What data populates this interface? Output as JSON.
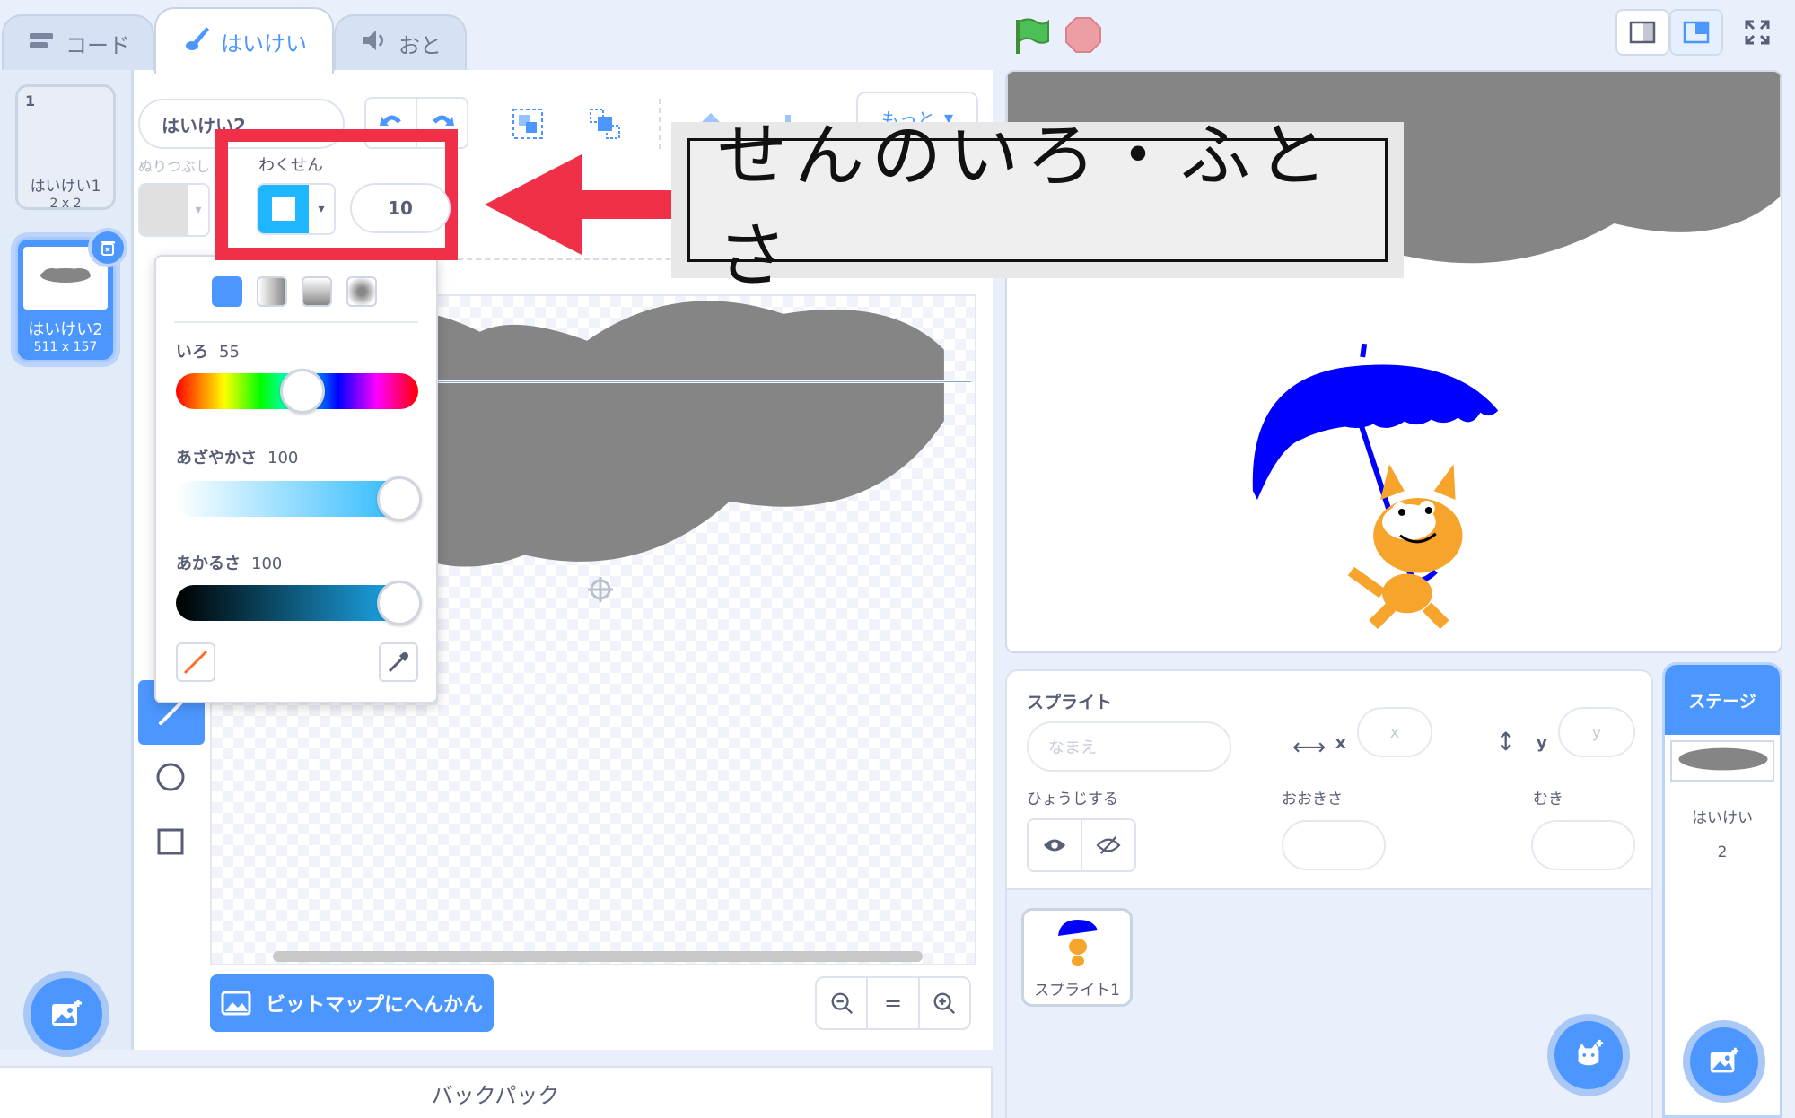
{
  "tabs": [
    {
      "label": "コード",
      "icon": "code-icon"
    },
    {
      "label": "はいけい",
      "icon": "brush-icon"
    },
    {
      "label": "おと",
      "icon": "speaker-icon"
    }
  ],
  "costumes": [
    {
      "number": "1",
      "name": "はいけい1",
      "size": "2 x 2"
    },
    {
      "number": "2",
      "name": "はいけい2",
      "size": "511 x 157"
    }
  ],
  "editor": {
    "costume_name": "はいけい2",
    "fill_label": "ぬりつぶし",
    "outline_label": "わくせん",
    "outline_width": "10",
    "more_label": "もっと",
    "convert_button": "ビットマップにへんかん",
    "zoom_reset": "="
  },
  "color_picker": {
    "hue_label": "いろ",
    "hue_value": "55",
    "saturation_label": "あざやかさ",
    "saturation_value": "100",
    "brightness_label": "あかるさ",
    "brightness_value": "100",
    "selected_color": "#4c97ff"
  },
  "annotation": {
    "text": "せんのいろ・ふとさ",
    "color": "#f03048"
  },
  "backpack": {
    "label": "バックパック"
  },
  "sprite_info": {
    "title": "スプライト",
    "name_placeholder": "なまえ",
    "x_label": "x",
    "x_placeholder": "x",
    "y_label": "y",
    "y_placeholder": "y",
    "show_label": "ひょうじする",
    "size_label": "おおきさ",
    "direction_label": "むき"
  },
  "sprites": [
    {
      "name": "スプライト1"
    }
  ],
  "stage_panel": {
    "title": "ステージ",
    "backdrops_label": "はいけい",
    "backdrops_count": "2"
  },
  "colors": {
    "accent": "#4c97ff",
    "cloud": "#858585",
    "umbrella": "#0000ff",
    "cat": "#f7a42d"
  }
}
